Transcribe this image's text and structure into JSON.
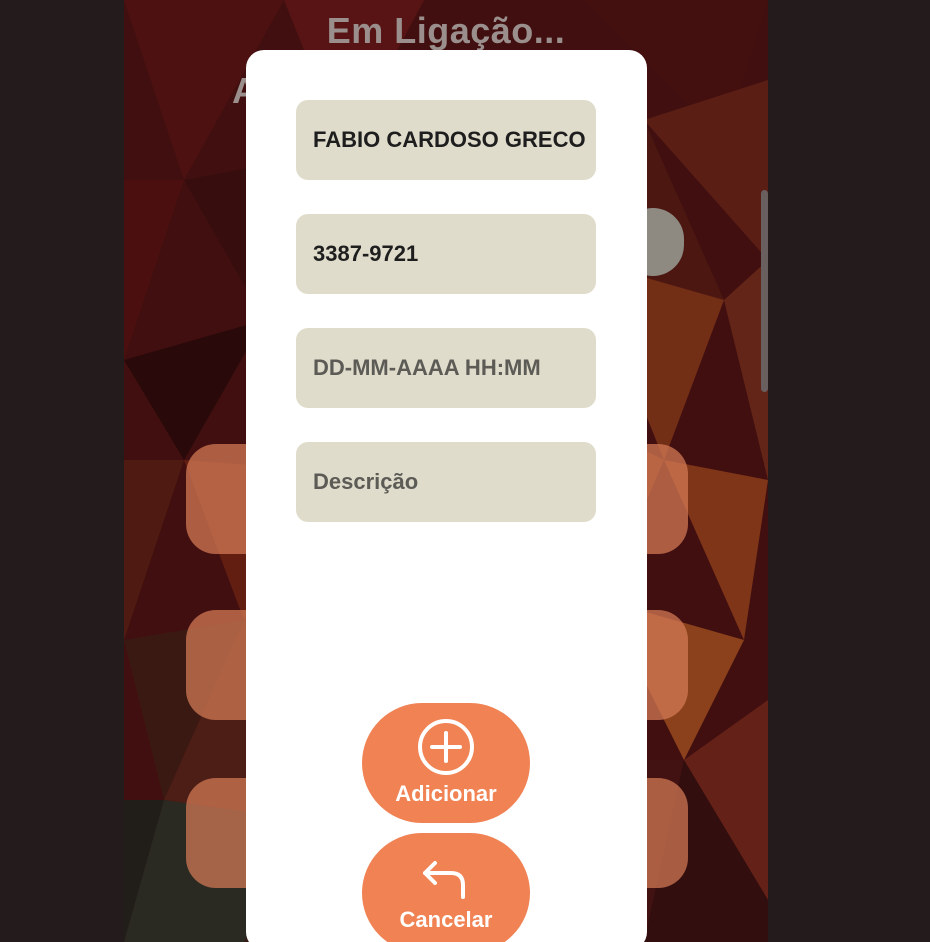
{
  "background": {
    "call_title": "Em Ligação...",
    "partial_text": "A"
  },
  "dialog": {
    "fields": {
      "name": {
        "value": "FABIO CARDOSO GRECO",
        "placeholder": ""
      },
      "phone": {
        "value": "3387-9721",
        "placeholder": ""
      },
      "datetime": {
        "value": "",
        "placeholder": "DD-MM-AAAA HH:MM"
      },
      "description": {
        "value": "",
        "placeholder": "Descrição"
      }
    },
    "add_button": {
      "label": "Adicionar",
      "icon": "plus-circle-icon"
    },
    "cancel_button": {
      "label": "Cancelar",
      "icon": "undo-arrow-icon"
    }
  },
  "colors": {
    "accent": "#f08253",
    "field_bg": "#e0dccb",
    "dialog_bg": "#ffffff",
    "backdrop": "#241c1c"
  }
}
